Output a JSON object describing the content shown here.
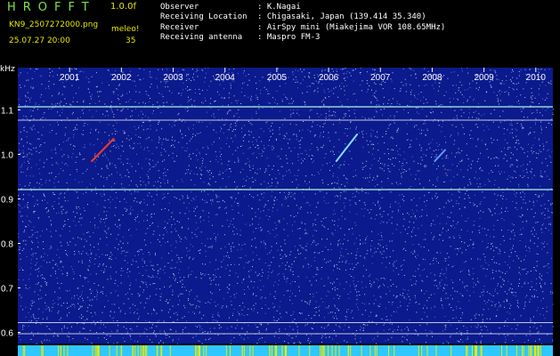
{
  "header": {
    "logo": "HROFFT",
    "version": "1.0.0f",
    "file_name": "KN9_2507272000.png",
    "meteor_label": "meleo!",
    "datetime": "25.07.27 20:00",
    "meteor_count": "35",
    "info_rows": [
      {
        "label": "Observer",
        "value": ": K.Nagai"
      },
      {
        "label": "Receiving Location",
        "value": ": Chigasaki, Japan (139.414 35.340)"
      },
      {
        "label": "Receiver",
        "value": ": AirSpy mini (Miakejima VOR 108.65MHz)"
      },
      {
        "label": "Receiving antenna",
        "value": ": Maspro FM-3"
      }
    ]
  },
  "chart_data": {
    "type": "heatmap",
    "ylabel": "kHz",
    "y_ticks": [
      "1.1",
      "1.0",
      "0.9",
      "0.8",
      "0.7",
      "0.6"
    ],
    "y_tick_values": [
      1.1,
      1.0,
      0.9,
      0.8,
      0.7,
      0.6
    ],
    "ylim": [
      0.575,
      1.195
    ],
    "x_ticks": [
      "2001",
      "2002",
      "2003",
      "2004",
      "2005",
      "2006",
      "2007",
      "2008",
      "2009",
      "2010"
    ],
    "x_tick_values": [
      20.01,
      20.02,
      20.03,
      20.04,
      20.05,
      20.06,
      20.07,
      20.08,
      20.09,
      20.1
    ],
    "xlim": [
      20.0,
      20.1033
    ],
    "horizontal_lines_khz": [
      1.107,
      1.077,
      0.921,
      0.622,
      0.597
    ],
    "meteor_echoes": [
      {
        "x": [
          20.0143,
          20.0185
        ],
        "y": [
          0.985,
          1.035
        ],
        "color": "#ff3b2a"
      },
      {
        "x": [
          20.0615,
          20.0655
        ],
        "y": [
          0.985,
          1.045
        ],
        "color": "#8ad9ff"
      },
      {
        "x": [
          20.0805,
          20.0825
        ],
        "y": [
          0.985,
          1.01
        ],
        "color": "#5ba0ff"
      }
    ],
    "background_color": "#0b1a8c",
    "noise_color": "#ffffff",
    "bottom_band_color": "#2ec7ff"
  }
}
